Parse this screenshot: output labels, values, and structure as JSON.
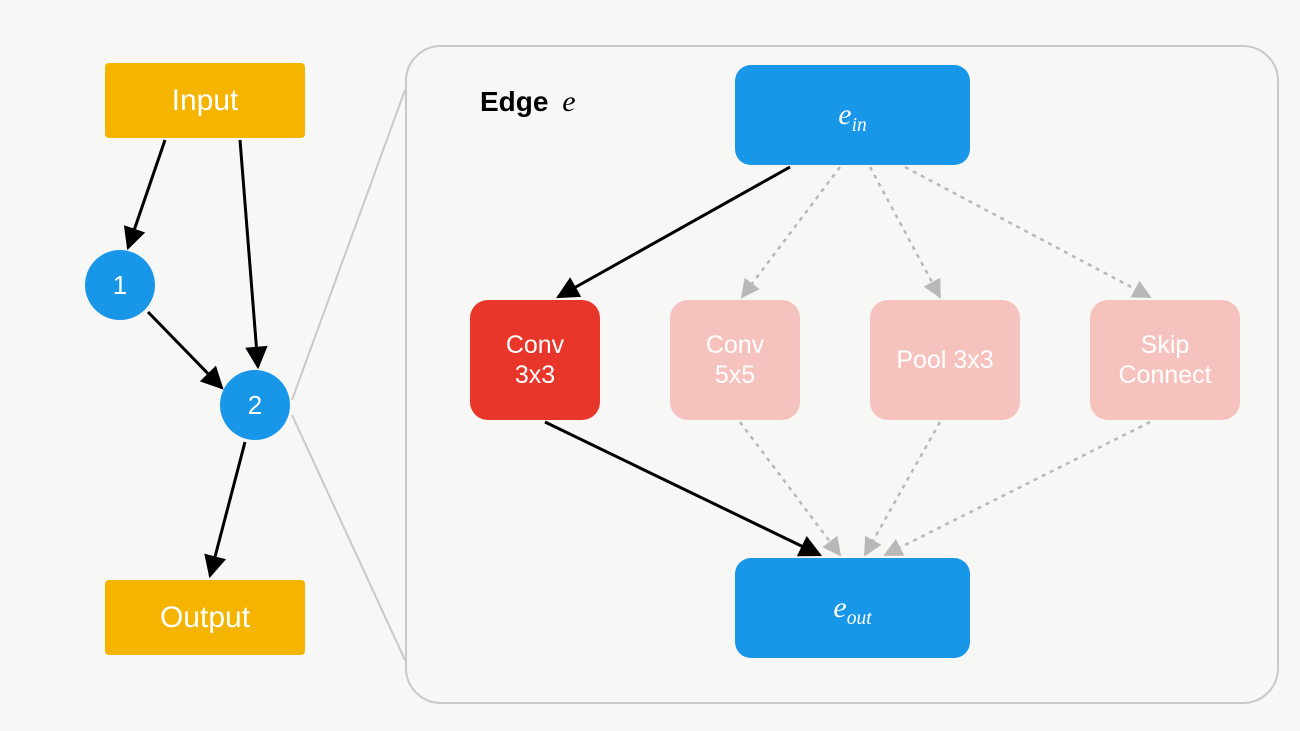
{
  "left_graph": {
    "input_label": "Input",
    "node1_label": "1",
    "node2_label": "2",
    "output_label": "Output"
  },
  "edge_panel": {
    "title_prefix": "Edge",
    "title_var": "e",
    "ein_prefix": "e",
    "ein_sub": "in",
    "eout_prefix": "e",
    "eout_sub": "out",
    "ops": {
      "conv3": "Conv\n3x3",
      "conv5": "Conv\n5x5",
      "pool3": "Pool 3x3",
      "skip": "Skip\nConnect"
    }
  }
}
